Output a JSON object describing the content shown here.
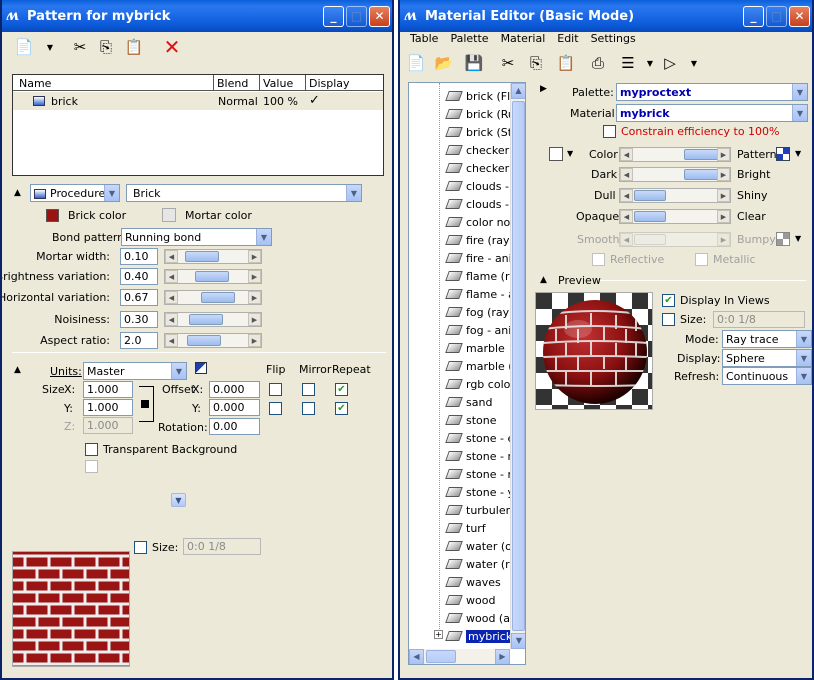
{
  "left": {
    "title": "Pattern for mybrick",
    "table": {
      "headers": [
        "Name",
        "Blend",
        "Value",
        "Display"
      ],
      "rows": [
        {
          "name": "brick",
          "blend": "Normal",
          "value": "100 %",
          "display": "✓"
        }
      ]
    },
    "procedure_combo": "Procedure",
    "brick_combo": "Brick",
    "brick_color_label": "Brick color",
    "mortar_color_label": "Mortar color",
    "brick_color": "#9a1212",
    "mortar_color": "#e6e6e6",
    "bond_pattern_label": "Bond pattern:",
    "bond_pattern_value": "Running bond",
    "params": [
      {
        "label": "Mortar width:",
        "value": "0.10"
      },
      {
        "label": "Brightness variation:",
        "value": "0.40"
      },
      {
        "label": "Horizontal variation:",
        "value": "0.67"
      },
      {
        "label": "Noisiness:",
        "value": "0.30"
      },
      {
        "label": "Aspect ratio:",
        "value": "2.0"
      }
    ],
    "units_label": "Units:",
    "units_value": "Master",
    "flip_label": "Flip",
    "mirror_label": "Mirror",
    "repeat_label": "Repeat",
    "size_label": "Size",
    "x_label": "X:",
    "y_label": "Y:",
    "z_label": "Z:",
    "size_x": "1.000",
    "size_y": "1.000",
    "size_z": "1.000",
    "offset_label": "Offset",
    "offset_x": "0.000",
    "offset_y": "0.000",
    "rotation_label": "Rotation:",
    "rotation": "0.00",
    "transparent_bg_label": "Transparent Background",
    "preview_size_label": "Size:",
    "preview_size_value": "0:0 1/8"
  },
  "right": {
    "title": "Material Editor (Basic Mode)",
    "menu": [
      "Table",
      "Palette",
      "Material",
      "Edit",
      "Settings"
    ],
    "materials": [
      "brick (Fle",
      "brick (Ru",
      "brick (Sta",
      "checker l",
      "checker l",
      "clouds - p",
      "clouds - v",
      "color nois",
      "fire (ray tr",
      "fire - anim",
      "flame (ray",
      "flame - ar",
      "fog (ray tr",
      "fog - anim",
      "marble",
      "marble (a",
      "rgb color",
      "sand",
      "stone",
      "stone - ea",
      "stone - m",
      "stone - re",
      "stone - ye",
      "turbulenc",
      "turf",
      "water (op",
      "water (ray",
      "waves",
      "wood",
      "wood (an",
      "mybrick"
    ],
    "palette_label": "Palette:",
    "palette_value": "myproctext",
    "material_label": "Material:",
    "material_value": "mybrick",
    "constrain_label": "Constrain efficiency to 100%",
    "color_label": "Color",
    "pattern_label": "Pattern",
    "dark_label": "Dark",
    "bright_label": "Bright",
    "dull_label": "Dull",
    "shiny_label": "Shiny",
    "opaque_label": "Opaque",
    "clear_label": "Clear",
    "smooth_label": "Smooth",
    "bumpy_label": "Bumpy",
    "reflective_label": "Reflective",
    "metallic_label": "Metallic",
    "preview_label": "Preview",
    "display_in_views_label": "Display In Views",
    "size_label": "Size:",
    "size_value": "0:0 1/8",
    "mode_label": "Mode:",
    "mode_value": "Ray trace",
    "display_label": "Display:",
    "display_value": "Sphere",
    "refresh_label": "Refresh:",
    "refresh_value": "Continuous"
  }
}
